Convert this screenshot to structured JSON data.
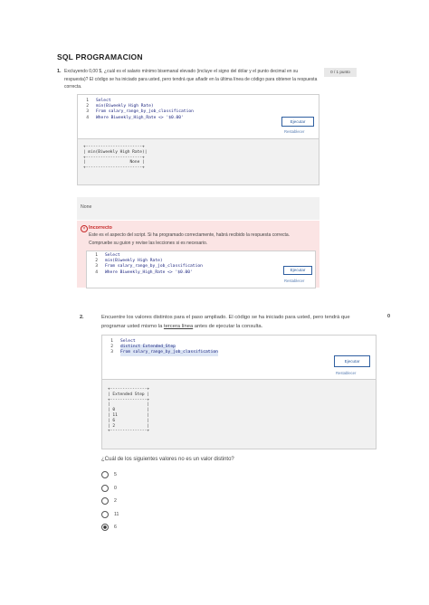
{
  "header": {
    "title": "SQL PROGRAMACION"
  },
  "q1": {
    "number": "1.",
    "text": "Excluyendo 0,00 $, ¿cuál es el salario mínimo bisemanal elevado (incluye el signo del dólar y el punto decimal en su respuesta)? El código se ha iniciado para usted, pero tendrá que añadir en la última línea de código para obtener la respuesta correcta.",
    "score": "0 / 1 punto",
    "code": [
      {
        "n": "1",
        "text": "Select"
      },
      {
        "n": "2",
        "text": "min(Biweekly High Rate)"
      },
      {
        "n": "3",
        "text": "From salary_range_by_job_classification"
      },
      {
        "n": "4",
        "text": "Where Biweekly_High_Rate <> '$0.00'"
      }
    ],
    "run_label": "Ejecutar",
    "reset_label": "Restablecer",
    "result": "+-----------------------+\n| min(Biweekly High Rate)|\n+-----------------------+\n|                  None |\n+-----------------------+"
  },
  "feedback": {
    "none_label": "None",
    "heading": "Incorrecto",
    "text": "Este es el aspecto del script. Si ha programado correctamente, habrá recibido la respuesta correcta. Compruebe su guion y revise las lecciones si es necesario.",
    "code": [
      {
        "n": "1",
        "text": "Select"
      },
      {
        "n": "2",
        "text": "min(Biweekly High Rate)"
      },
      {
        "n": "3",
        "text": "From salary_range_by_job_classification"
      },
      {
        "n": "4",
        "text": "Where Biweekly_High_Rate <> '$0.00'"
      }
    ],
    "run_label": "Ejecutar",
    "reset_label": "Restablecer"
  },
  "q2": {
    "number": "2.",
    "text_before": "Encuentre los valores distintos para el paso ampliado. El código se ha iniciado para usted, pero tendrá que programar usted mismo la ",
    "text_link": "tercera línea",
    "text_after": " antes de ejecutar la consulta.",
    "score": "0",
    "code": [
      {
        "n": "1",
        "text": "Select"
      },
      {
        "n": "2",
        "text": "distinct Extended_Step"
      },
      {
        "n": "3",
        "text": "From salary_range_by_job_classification"
      }
    ],
    "run_label": "Ejecutar",
    "reset_label": "Restablecer",
    "result": "+---------------+\n| Extended Step |\n+---------------+\n|               |\n| 0             |\n| 11            |\n| 6             |\n| 2             |\n+---------------+",
    "question": "¿Cuál de los siguientes valores no es un valor distinto?",
    "options": [
      "5",
      "0",
      "2",
      "11",
      "6"
    ],
    "selected_index": 4
  }
}
